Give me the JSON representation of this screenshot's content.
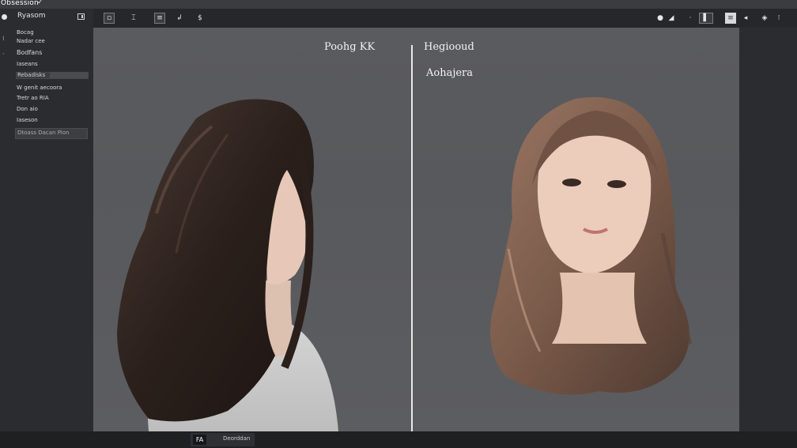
{
  "window": {
    "title": "Obsession"
  },
  "sidebar": {
    "header_label": "Ryasom",
    "items": [
      {
        "label": "Bocag"
      },
      {
        "label": "Nadar cee"
      },
      {
        "label": "Bodfans"
      },
      {
        "label": "Iaseans"
      },
      {
        "label": "Rebadisks"
      },
      {
        "label": "W genit aecoora"
      },
      {
        "label": "Tretr ao RIA"
      },
      {
        "label": "Don aio"
      },
      {
        "label": "Iaseson"
      }
    ],
    "select_label": "Dtoass Dacan Pion"
  },
  "toolbar": {
    "icons": [
      "frame-icon",
      "text-cursor-icon",
      "list-icon",
      "arrow-icon",
      "currency-icon"
    ],
    "right_icons": [
      "pin-icon",
      "brush-icon",
      "dot-icon",
      "layout-icon",
      "document-icon",
      "pen-icon",
      "eye-icon"
    ]
  },
  "canvas": {
    "left_label": "Poohg KK",
    "right_label_1": "Hegiooud",
    "right_label_2": "Aohajera"
  },
  "bottom": {
    "tab_icon_label": "FA",
    "tab_label": "Deorddan"
  },
  "colors": {
    "background": "#2b2d30",
    "canvas": "#5a5b5e",
    "divider": "#e9e9e9",
    "hair_dark": "#2d221e",
    "hair_brown": "#7a5a49",
    "skin": "#e9c9b8"
  }
}
